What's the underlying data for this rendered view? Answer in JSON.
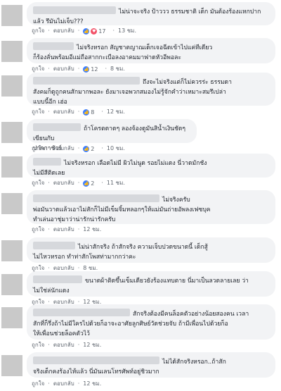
{
  "labels": {
    "like": "ถูกใจ",
    "reply": "ตอบกลับ",
    "sep": "·"
  },
  "colors": {
    "bubble": "#f2f3f5",
    "like": "#4080ff",
    "love": "#f25268",
    "meta": "#606770"
  },
  "comments": [
    {
      "text": "ไม่น่าจะจริง ป้าววว ธรรมชาติ เด็ก มันต้องร้องแหกปาก\nแล้ว รึมันไม่เจ็บ???",
      "reactions": "17",
      "time": "13 ชม."
    },
    {
      "text": "ไม่จริงหรอก สัญชาตญาณเด็กเจอฉีดเข้าไปแค่ทีเดียว\nก็ร้องลั่นพร้อมอีแม่ถือสากกะเบือลงอาคมมาฟาดหัวอีพอละ",
      "reactions": "12",
      "time": "8 ชม."
    },
    {
      "text": "ถึงจะไม่จริงแต่ก็ไม่ควรร่ะ ธรรมดา\nสังคมก็ดูถูกคนสักมากพอละ ยังมาเจอพวกสมองไม่รู้จักคำว่าเหมาะสมรึเปล่า\nแบบนี้อีก เฮ่อ",
      "reactions": "8",
      "time": "12 ชม."
    },
    {
      "text": "ถ้าโครตดาดๆ ลองจ้องดูมันสิน้ำเงินชัดๆ เขียนกับ\nปากกาชัวร์",
      "reactions": "2",
      "time": "10 ชม."
    },
    {
      "text": "ไม่จริงหรอก เลือดไม่มี ผิวไม่นูด รอยไม่แดง นี่วาดมักชัง\nไม่มีสีติดเลย",
      "reactions": "2",
      "time": "11 ชม."
    },
    {
      "text": "ไม่จริงครับ\nพ่อมันวาดแล้วเอาไม่สักก็ไม่มีเข็มจิ้มหลอกๆให้แม่มันถ่ายอัพลงเฟซบุค\nทำเล่นอาชุ่มาว่าน่ารักน่ารักครับ",
      "reactions": "",
      "time": "12 ชม."
    },
    {
      "text": "ไม่น่าสักจริง ถ้าสักจริง ความเจ็บปวดขนาดนี้ เด็กสู้\nไม่ไหวหรอก ทำท่าสักโพสท่ามากกว่าคะ",
      "reactions": "",
      "time": "8 ชม."
    },
    {
      "text": "ขนาดผ้าติดขึ้นเข็มเดียวยังร้องแทบตาย นี่มาเป็นลวดลายเลย ว่า\nไม่ใช่ล่นักแดง",
      "reactions": "",
      "time": "12 ชม."
    },
    {
      "text": "สักจริงต้องมีคนล็อคตัวอย่างน้อยสองคน เวลา\nสักที่ก็รึ่งถ้าไม่มีใครไปด้วยก็อาจะอาศัยลูกศิษย์วัดช่วยจับ ถ้ามีเพื่อนไปด้วยก็อ\nให้เพื่อนช่วยล็อคตัวไว้",
      "reactions": "",
      "time": "12 ชม."
    },
    {
      "text": "ไม่ได้สักจริงหรอก..ถ้าสัก\nจริงเด็กคงร้องไห้แล้ว นี่มันเลนโทรศัพท์อยู่ชิวมาก",
      "reactions": "",
      "time": "12 ชม."
    }
  ]
}
